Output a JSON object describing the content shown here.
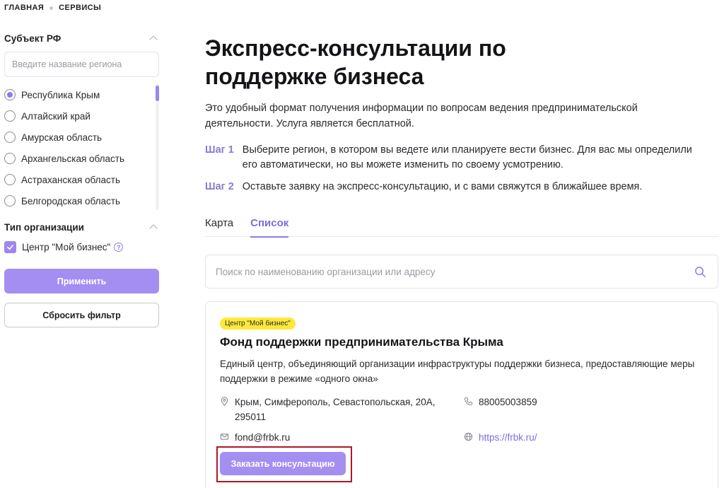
{
  "breadcrumb": [
    "ГЛАВНАЯ",
    "СЕРВИСЫ"
  ],
  "sidebar": {
    "region_filter": {
      "title": "Субъект РФ",
      "search_placeholder": "Введите название региона",
      "selected": "Республика Крым",
      "regions": [
        {
          "label": "Республика Крым",
          "checked": true
        },
        {
          "label": "Алтайский край",
          "checked": false
        },
        {
          "label": "Амурская область",
          "checked": false
        },
        {
          "label": "Архангельская область",
          "checked": false
        },
        {
          "label": "Астраханская область",
          "checked": false
        },
        {
          "label": "Белгородская область",
          "checked": false
        }
      ]
    },
    "org_type_filter": {
      "title": "Тип организации",
      "options": [
        {
          "label": "Центр \"Мой бизнес\"",
          "checked": true
        }
      ]
    },
    "apply_label": "Применить",
    "reset_label": "Сбросить фильтр"
  },
  "main": {
    "title": "Экспресс-консультации по поддержке бизнеса",
    "intro": "Это удобный формат получения информации по вопросам ведения предпринимательской деятельности. Услуга является бесплатной.",
    "steps": [
      {
        "label": "Шаг 1",
        "text": "Выберите регион, в котором вы ведете или планируете вести бизнес. Для вас мы определили его автоматически, но вы можете изменить по своему усмотрению."
      },
      {
        "label": "Шаг 2",
        "text": "Оставьте заявку на экспресс-консультацию, и с вами свяжутся в ближайшее время."
      }
    ],
    "tabs": [
      {
        "label": "Карта",
        "active": false
      },
      {
        "label": "Список",
        "active": true
      }
    ],
    "search_placeholder": "Поиск по наименованию организации или адресу",
    "organizations": [
      {
        "tag": "Центр \"Мой бизнес\"",
        "name": "Фонд поддержки предпринимательства Крыма",
        "description": "Единый центр, объединяющий организации инфраструктуры поддержки бизнеса, предоставляющие меры поддержки в режиме «одного окна»",
        "address": "Крым, Симферополь, Севастопольская, 20А, 295011",
        "phone": "88005003859",
        "email": "fond@frbk.ru",
        "website": "https://frbk.ru/",
        "order_label": "Заказать консультацию"
      }
    ]
  },
  "colors": {
    "accent": "#a48ef2",
    "accent_text": "#7f6bd8",
    "tag_bg": "#ffe83a",
    "highlight": "#b0172a"
  }
}
